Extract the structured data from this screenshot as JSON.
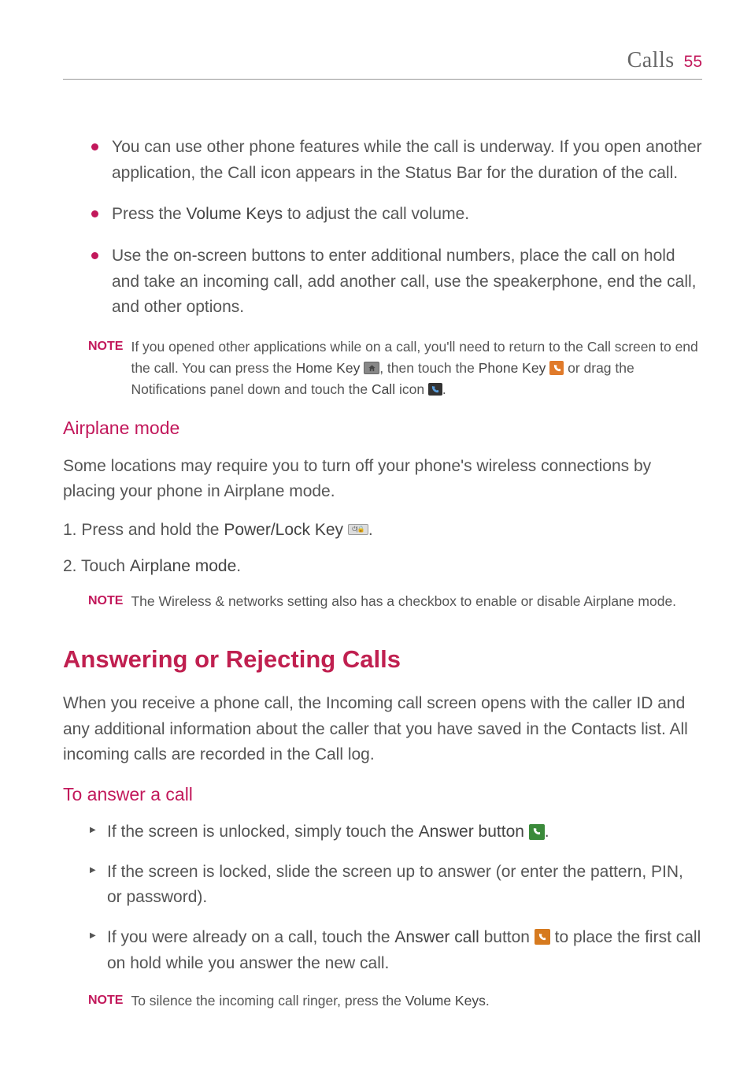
{
  "header": {
    "section": "Calls",
    "page": "55"
  },
  "bullets": [
    "You can use other phone features while the call is underway. If you open another application, the Call icon appears in the Status Bar for the duration of the call.",
    {
      "prefix": "Press the ",
      "bold": "Volume Keys",
      "suffix": " to adjust the call volume."
    },
    "Use the on-screen buttons to enter additional numbers, place the call on hold and take an incoming call, add another call, use the speakerphone, end the call, and other options."
  ],
  "note1": {
    "label": "NOTE",
    "pre": "If you opened other applications while on a call, you'll need to return to the Call screen to end the call. You can press the ",
    "home_key": "Home Key",
    "comma_then": ", then touch the ",
    "phone_key": "Phone Key",
    "or_drag": " or drag the Notifications panel down and touch the ",
    "call_icon": "Call",
    "icon_word": " icon ",
    "period": "."
  },
  "airplane": {
    "heading": "Airplane mode",
    "intro": "Some locations may require you to turn off your phone's wireless connections by placing your phone in Airplane mode.",
    "step1_pre": "1. Press and hold the ",
    "step1_bold": "Power/Lock Key",
    "step1_post": ".",
    "step2_pre": "2. Touch ",
    "step2_bold": "Airplane mode",
    "step2_post": "."
  },
  "note2": {
    "label": "NOTE",
    "text": "The Wireless & networks setting also has a checkbox to enable or disable Airplane mode."
  },
  "answering": {
    "heading": "Answering or Rejecting Calls",
    "intro": "When you receive a phone call, the Incoming call screen opens with the caller ID and any additional information about the caller that you have saved in the Contacts list. All incoming calls are recorded in the Call log.",
    "sub": "To answer a call",
    "item1_pre": "If the screen is unlocked, simply touch the ",
    "item1_bold": "Answer button",
    "item1_post": ".",
    "item2": "If the screen is locked, slide the screen up to answer (or enter the pattern, PIN, or password).",
    "item3_pre": "If you were already on a call, touch the ",
    "item3_bold": "Answer call",
    "item3_mid": " button ",
    "item3_post": " to place the first call  on hold while you answer the new call."
  },
  "note3": {
    "label": "NOTE",
    "pre": "To silence the incoming call ringer, press the ",
    "bold": "Volume Keys",
    "post": "."
  }
}
